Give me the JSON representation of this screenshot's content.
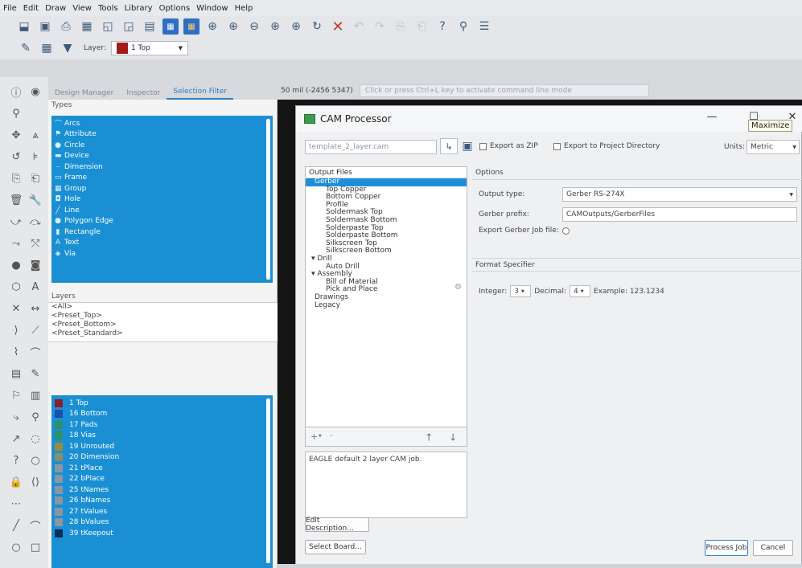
{
  "menubar": {
    "items": [
      "File",
      "Edit",
      "Draw",
      "View",
      "Tools",
      "Library",
      "Options",
      "Window",
      "Help"
    ]
  },
  "toolbar": {
    "icons": [
      "open-icon",
      "save-icon",
      "print-icon",
      "cam-icon",
      "board-icon",
      "schematic-icon",
      "layers-icon",
      "board-view-icon",
      "schematic-view-icon",
      "zoom-fit-icon",
      "zoom-in-icon",
      "zoom-out-icon",
      "zoom-select-icon",
      "zoom-last-icon",
      "redraw-icon",
      "stop-icon",
      "undo-icon",
      "redo-icon",
      "copy-icon",
      "paste-icon",
      "help-icon",
      "design-link-icon",
      "bom-icon"
    ]
  },
  "layerbar": {
    "layer_label": "Layer:",
    "layer_value": "1 Top",
    "layer_color": "#a01c1c"
  },
  "panel": {
    "tabs": [
      "Design Manager",
      "Inspector",
      "Selection Filter"
    ],
    "active_tab": "Selection Filter",
    "types_label": "Types",
    "types": [
      "Arcs",
      "Attribute",
      "Circle",
      "Device",
      "Dimension",
      "Frame",
      "Group",
      "Hole",
      "Line",
      "Polygon Edge",
      "Rectangle",
      "Text",
      "Via"
    ],
    "layers_label": "Layers",
    "layer_presets": [
      "<All>",
      "<Preset_Top>",
      "<Preset_Bottom>",
      "<Preset_Standard>"
    ],
    "layers": [
      {
        "name": "1 Top",
        "color": "#8b1d2c"
      },
      {
        "name": "16 Bottom",
        "color": "#1b4fa8"
      },
      {
        "name": "17 Pads",
        "color": "#2f8f6a"
      },
      {
        "name": "18 Vias",
        "color": "#2f8f6a"
      },
      {
        "name": "19 Unrouted",
        "color": "#9b8a3a"
      },
      {
        "name": "20 Dimension",
        "color": "#8d8d6a"
      },
      {
        "name": "21 tPlace",
        "color": "#8d95a0"
      },
      {
        "name": "22 bPlace",
        "color": "#8d95a0"
      },
      {
        "name": "25 tNames",
        "color": "#8d95a0"
      },
      {
        "name": "26 bNames",
        "color": "#8d95a0"
      },
      {
        "name": "27 tValues",
        "color": "#8d95a0"
      },
      {
        "name": "28 bValues",
        "color": "#8d95a0"
      },
      {
        "name": "39 tKeepout",
        "color": "#0e2b57"
      }
    ]
  },
  "main": {
    "coords": "50 mil (-2456 5347)",
    "command_placeholder": "Click or press Ctrl+L key to activate command line mode"
  },
  "dialog": {
    "title": "CAM Processor",
    "tooltip": "Maximize",
    "job_file": "template_2_layer.cam",
    "export_zip": "Export as ZIP",
    "export_dir": "Export to Project Directory",
    "units_label": "Units:",
    "units_value": "Metric",
    "output_files_label": "Output Files",
    "tree": [
      {
        "label": "Gerber",
        "indent": 1,
        "selected": true
      },
      {
        "label": "Top Copper",
        "indent": 3
      },
      {
        "label": "Bottom Copper",
        "indent": 3
      },
      {
        "label": "Profile",
        "indent": 3
      },
      {
        "label": "Soldermask Top",
        "indent": 3
      },
      {
        "label": "Soldermask Bottom",
        "indent": 3
      },
      {
        "label": "Solderpaste Top",
        "indent": 3
      },
      {
        "label": "Solderpaste Bottom",
        "indent": 3
      },
      {
        "label": "Silkscreen Top",
        "indent": 3
      },
      {
        "label": "Silkscreen Bottom",
        "indent": 3
      },
      {
        "label": "Drill",
        "indent": 1,
        "bullet": true
      },
      {
        "label": "Auto Drill",
        "indent": 3
      },
      {
        "label": "Assembly",
        "indent": 1,
        "bullet": true
      },
      {
        "label": "Bill of Material",
        "indent": 3
      },
      {
        "label": "Pick and Place",
        "indent": 3
      },
      {
        "label": "Drawings",
        "indent": 1
      },
      {
        "label": "Legacy",
        "indent": 1
      }
    ],
    "options_label": "Options",
    "output_type_label": "Output type:",
    "output_type_value": "Gerber RS-274X",
    "gerber_prefix_label": "Gerber prefix:",
    "gerber_prefix_value": "CAMOutputs/GerberFiles",
    "export_job_label": "Export Gerber Job file:",
    "format_label": "Format Specifier",
    "integer_label": "Integer:",
    "integer_value": "3",
    "decimal_label": "Decimal:",
    "decimal_value": "4",
    "example_label": "Example: 123.1234",
    "description": "EAGLE default 2 layer CAM job.",
    "edit_description": "Edit Description...",
    "select_board": "Select Board...",
    "process_job": "Process Job",
    "cancel": "Cancel"
  }
}
